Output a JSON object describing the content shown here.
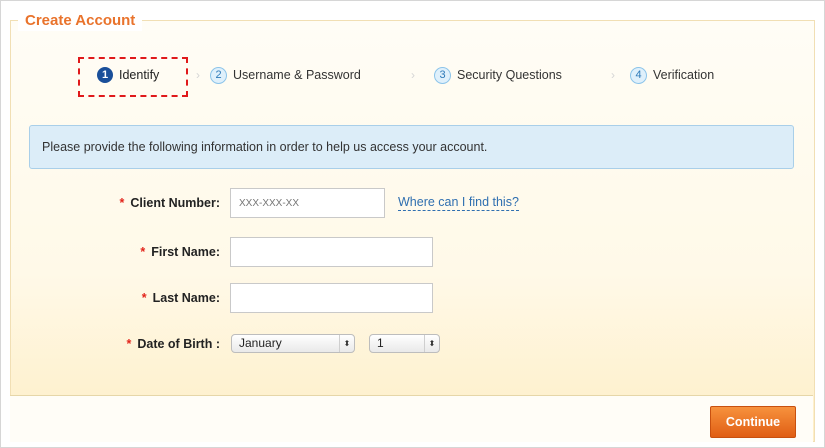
{
  "form": {
    "legend": "Create Account"
  },
  "steps": [
    {
      "number": "1",
      "label": "Identify",
      "active": true
    },
    {
      "number": "2",
      "label": "Username & Password",
      "active": false
    },
    {
      "number": "3",
      "label": "Security Questions",
      "active": false
    },
    {
      "number": "4",
      "label": "Verification",
      "active": false
    }
  ],
  "info": {
    "message": "Please provide the following information in order to help us access your account."
  },
  "fields": {
    "client_number": {
      "label": "Client Number:",
      "placeholder": "XXX-XXX-XX",
      "value": "",
      "help_link": "Where can I find this?"
    },
    "first_name": {
      "label": "First Name:",
      "value": ""
    },
    "last_name": {
      "label": "Last Name:",
      "value": ""
    },
    "dob": {
      "label": "Date of Birth :",
      "month": "January",
      "day": "1"
    }
  },
  "required_marker": "*",
  "select_arrow": "⬍",
  "actions": {
    "continue_label": "Continue"
  },
  "colors": {
    "accent_orange": "#e9732c",
    "step_active": "#1a4f9a",
    "info_bg": "#dcedf8",
    "required": "#e2231a",
    "highlight_border": "#e0191b"
  }
}
